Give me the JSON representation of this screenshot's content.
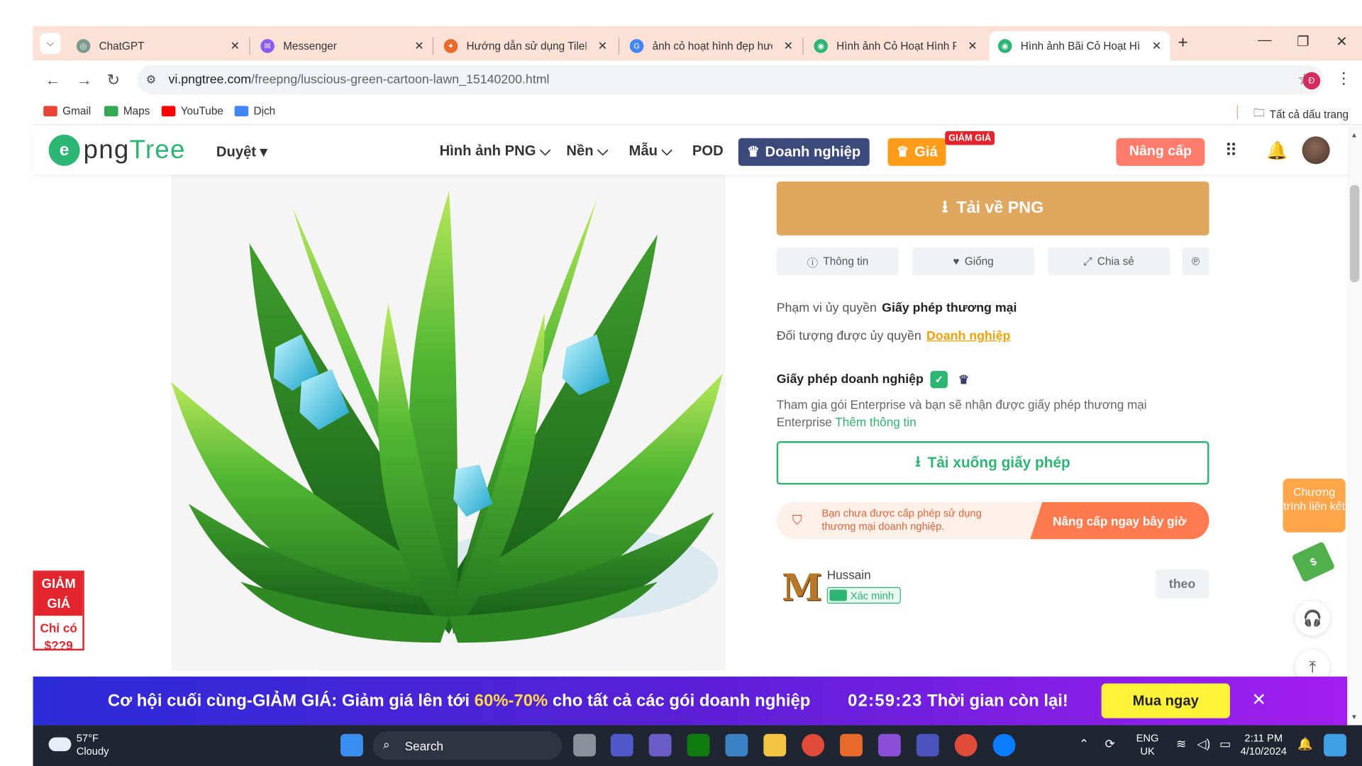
{
  "browser": {
    "tabs": [
      {
        "title": "ChatGPT",
        "color": "#7a9a8c",
        "glyph": "◎",
        "active": false
      },
      {
        "title": "Messenger",
        "color": "#8a5cf0",
        "glyph": "✉",
        "active": false
      },
      {
        "title": "Hướng dẫn sử dụng TileM",
        "color": "#e96a2a",
        "glyph": "✦",
        "active": false
      },
      {
        "title": "ảnh cỏ hoạt hình đẹp hướ",
        "color": "#4285f4",
        "glyph": "G",
        "active": false
      },
      {
        "title": "Hình ảnh Cỏ Hoạt Hình PN",
        "color": "#2bb673",
        "glyph": "◉",
        "active": false
      },
      {
        "title": "Hình ảnh Bãi Cỏ Hoạt Hình",
        "color": "#2bb673",
        "glyph": "◉",
        "active": true
      }
    ],
    "url_host": "vi.pngtree.com",
    "url_path": "/freepng/luscious-green-cartoon-lawn_15140200.html",
    "profile_initial": "Đ",
    "bookmarks": [
      {
        "label": "Gmail",
        "color": "#ea4335"
      },
      {
        "label": "Maps",
        "color": "#34a853"
      },
      {
        "label": "YouTube",
        "color": "#ff0000"
      },
      {
        "label": "Dịch",
        "color": "#4285f4"
      }
    ],
    "all_bookmarks": "Tất cả dấu trang"
  },
  "site": {
    "logo": "pngtree",
    "browse": "Duyệt ▾",
    "nav": [
      "Hình ảnh PNG ⌵",
      "Nền ⌵",
      "Mẫu ⌵",
      "POD"
    ],
    "enterprise": "Doanh nghiệp",
    "price": "Giá",
    "sale_tag": "GIẢM GIÁ",
    "upgrade": "Nâng cấp"
  },
  "detail": {
    "download_png": "Tải về PNG",
    "info": "Thông tin",
    "like": "Giống",
    "share": "Chia sẻ",
    "pinterest": "℗",
    "scope_label": "Phạm vi ủy quyền",
    "scope_value": "Giấy phép thương mại",
    "target_label": "Đối tượng được ủy quyền",
    "target_value": "Doanh nghiệp",
    "license_title": "Giấy phép doanh nghiệp",
    "license_desc": "Tham gia gói Enterprise và bạn sẽ nhận được giấy phép thương mại Enterprise ",
    "license_more": "Thêm thông tin",
    "license_download": "Tải xuống giấy phép",
    "warning_text": "Bạn chưa được cấp phép sử dụng thương mại doanh nghiệp.",
    "warning_button": "Nâng cấp ngay bây giờ",
    "author_name": "Hussain",
    "author_verified": "Xác minh",
    "follow": "theo"
  },
  "promo_left": {
    "top": "GIẢM GIÁ",
    "bottom": "Chỉ có $??9"
  },
  "affiliate": "Chương trình liên kết",
  "banner": {
    "text_before": "Cơ hội cuối cùng-GIẢM GIÁ: Giảm giá lên tới ",
    "highlight": "60%-70%",
    "text_after": " cho tất cả các gói doanh nghiệp",
    "timer": "02:59:23",
    "timer_suffix": " Thời gian còn lại!",
    "buy": "Mua ngay"
  },
  "taskbar": {
    "temp": "57°F",
    "weather": "Cloudy",
    "search": "Search",
    "lang_top": "ENG",
    "lang_bottom": "UK",
    "time": "2:11 PM",
    "date": "4/10/2024"
  }
}
